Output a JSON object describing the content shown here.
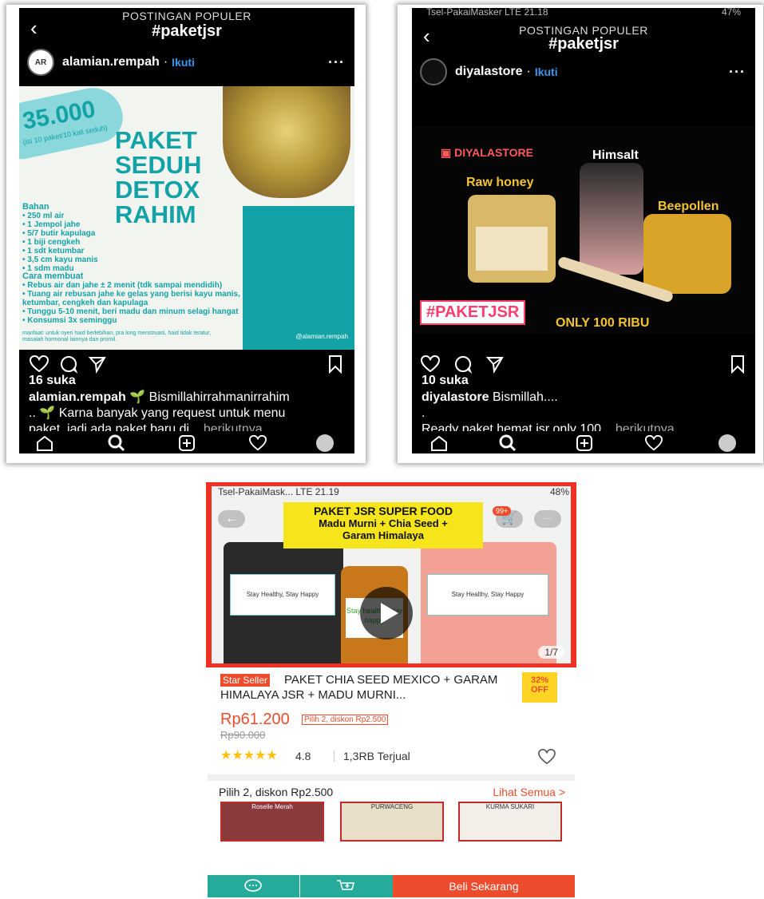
{
  "post1": {
    "screen_title": "POSTINGAN POPULER",
    "hashtag": "#paketjsr",
    "username": "alamian.rempah",
    "follow": "Ikuti",
    "image": {
      "price": "35.000",
      "price_sub": "(isi 10 paket/10 kali seduh)",
      "headline": "PAKET SEDUH DETOX RAHIM",
      "bahan_title": "Bahan",
      "bahan": [
        "250 ml air",
        "1 Jempol jahe",
        "5/7 butir kapulaga",
        "1 biji cengkeh",
        "1 sdt ketumbar",
        "3,5 cm kayu manis",
        "1 sdm madu"
      ],
      "cara_title": "Cara membuat",
      "cara": [
        "Rebus air dan jahe ± 2 menit (tdk sampai mendidih)",
        "Tuang air rebusan jahe ke gelas yang berisi kayu manis, ketumbar, cengkeh dan kapulaga",
        "Tunggu 5-10 menit, beri madu dan minum selagi hangat",
        "Konsumsi 3x seminggu"
      ],
      "note": "manfaat: untuk nyeri haid berlebihan, pra long menstruasi, haid tidak teratur, masalah hormonal lainnya dan promil.",
      "handle": "@alamian.rempah"
    },
    "likes": "16 suka",
    "caption_user": "alamian.rempah",
    "caption_line1": "🌱 Bismillahirrahmanirrahim",
    "caption_line2": ".. 🌱 Karna banyak yang request untuk menu",
    "caption_line3": "paket, jadi ada paket baru di...",
    "more": "berikutnya"
  },
  "post2": {
    "status": "Tsel-PakaiMasker  LTE   21.18",
    "battery": "47%",
    "screen_title": "POSTINGAN POPULER",
    "hashtag": "#paketjsr",
    "username": "diyalastore",
    "follow": "Ikuti",
    "image": {
      "brand": "DIYALASTORE",
      "label_himsalt": "Himsalt",
      "label_rawhoney": "Raw honey",
      "label_beepollen": "Beepollen",
      "hashtag": "#PAKETJSR",
      "price": "ONLY 100 RIBU"
    },
    "likes": "10 suka",
    "caption_user": "diyalastore",
    "caption_line1": "Bismillah....",
    "caption_line2": ".",
    "caption_line3": "Ready paket hemat jsr only 100...",
    "more": "berikutnya"
  },
  "shop": {
    "status_left": "Tsel-PakaiMask...  LTE    21.19",
    "battery": "48%",
    "cart_badge": "99+",
    "banner_line1": "PAKET JSR SUPER FOOD",
    "banner_line2": "Madu Murni + Chia Seed +",
    "banner_line3": "Garam Himalaya",
    "bag_label": "Stay Healthy, Stay Happy",
    "bottle_label": "Stay healthy Stay happy",
    "image_counter": "1/7",
    "star_seller": "Star Seller",
    "title": "PAKET CHIA SEED MEXICO + GARAM HIMALAYA JSR + MADU MURNI...",
    "discount_pct": "32%",
    "discount_off": "OFF",
    "price": "Rp61.200",
    "promo": "Pilih 2, diskon Rp2.500",
    "original_price": "Rp90.000",
    "stars": "★★★★★",
    "rating": "4.8",
    "sold": "1,3RB Terjual",
    "bundle_title": "Pilih 2, diskon Rp2.500",
    "see_all": "Lihat Semua >",
    "thumbs": [
      "Roselle Merah",
      "PURWACENG",
      "KURMA SUKARI"
    ],
    "buy_now": "Beli Sekarang"
  },
  "colors": {
    "instagram_bg": "#000000",
    "follow_blue": "#3897f0",
    "teal": "#13a3a6",
    "shopee_orange": "#ee4d2d",
    "shopee_teal": "#26aa99",
    "highlight_red": "#ee3124"
  }
}
